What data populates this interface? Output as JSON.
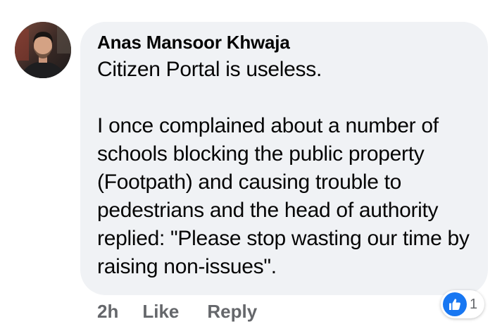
{
  "comment": {
    "author": "Anas Mansoor Khwaja",
    "paragraphs": [
      "Citizen Portal is useless.",
      "I once complained about a number of schools blocking the public property (Footpath) and causing trouble to pedestrians and the head of authority replied: \"Please stop wasting our time by raising non-issues\"."
    ],
    "timestamp": "2h",
    "actions": {
      "like_label": "Like",
      "reply_label": "Reply"
    },
    "reactions": {
      "icon": "thumbs-up-icon",
      "count": "1"
    }
  },
  "colors": {
    "bubble_background": "#f0f2f5",
    "text": "#050505",
    "secondary_text": "#65676b",
    "like_blue": "#1877f2"
  }
}
